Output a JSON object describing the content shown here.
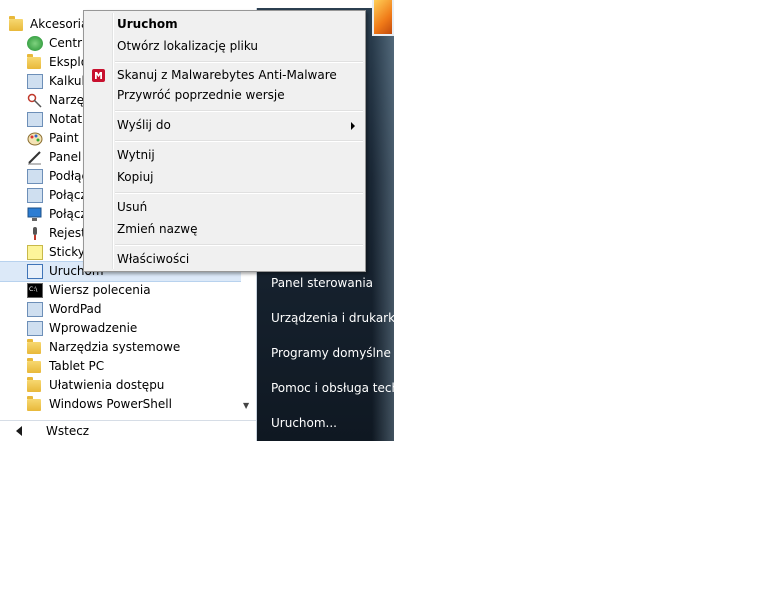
{
  "program_list": {
    "parent_folder": "Akcesoria",
    "items": [
      {
        "label": "Centrum",
        "icon": "sync-center-icon"
      },
      {
        "label": "Eksplo",
        "icon": "explorer-icon"
      },
      {
        "label": "Kalkul",
        "icon": "calculator-icon"
      },
      {
        "label": "Narzędz",
        "icon": "snipping-tool-icon"
      },
      {
        "label": "Notatn",
        "icon": "notepad-icon"
      },
      {
        "label": "Paint",
        "icon": "paint-icon"
      },
      {
        "label": "Panel",
        "icon": "tablet-input-icon"
      },
      {
        "label": "Podłąc",
        "icon": "network-projector-icon"
      },
      {
        "label": "Połącz",
        "icon": "mobility-icon"
      },
      {
        "label": "Połącz",
        "icon": "remote-desktop-icon"
      },
      {
        "label": "Rejestr",
        "icon": "sound-recorder-icon"
      },
      {
        "label": "Sticky",
        "icon": "sticky-notes-icon"
      },
      {
        "label": "Uruchom",
        "icon": "run-icon"
      },
      {
        "label": "Wiersz polecenia",
        "icon": "cmd-icon"
      },
      {
        "label": "WordPad",
        "icon": "wordpad-icon"
      },
      {
        "label": "Wprowadzenie",
        "icon": "getting-started-icon"
      },
      {
        "label": "Narzędzia systemowe",
        "icon": "folder-icon"
      },
      {
        "label": "Tablet PC",
        "icon": "folder-icon"
      },
      {
        "label": "Ułatwienia dostępu",
        "icon": "folder-icon"
      },
      {
        "label": "Windows PowerShell",
        "icon": "folder-icon"
      }
    ],
    "selected_index": 12
  },
  "back_button": {
    "label": "Wstecz"
  },
  "right_panel": {
    "items": [
      "Panel sterowania",
      "Urządzenia i drukarki",
      "Programy domyślne",
      "Pomoc i obsługa techn",
      "Uruchom..."
    ]
  },
  "context_menu": {
    "items": [
      {
        "label": "Uruchom",
        "bold": true
      },
      {
        "label": "Otwórz lokalizację pliku"
      },
      {
        "label": "Skanuj z Malwarebytes Anti-Malware",
        "icon": "malwarebytes-icon"
      },
      {
        "label": "Przywróć poprzednie wersje"
      },
      {
        "label": "Wyślij do",
        "submenu": true
      },
      {
        "label": "Wytnij"
      },
      {
        "label": "Kopiuj"
      },
      {
        "label": "Usuń"
      },
      {
        "label": "Zmień nazwę"
      },
      {
        "label": "Właściwości"
      }
    ]
  },
  "colors": {
    "selection": "#dce9f8",
    "right_panel_bg": "#1a2735",
    "menu_bg": "#f0f0f0",
    "malwarebytes_red": "#c8102e"
  }
}
